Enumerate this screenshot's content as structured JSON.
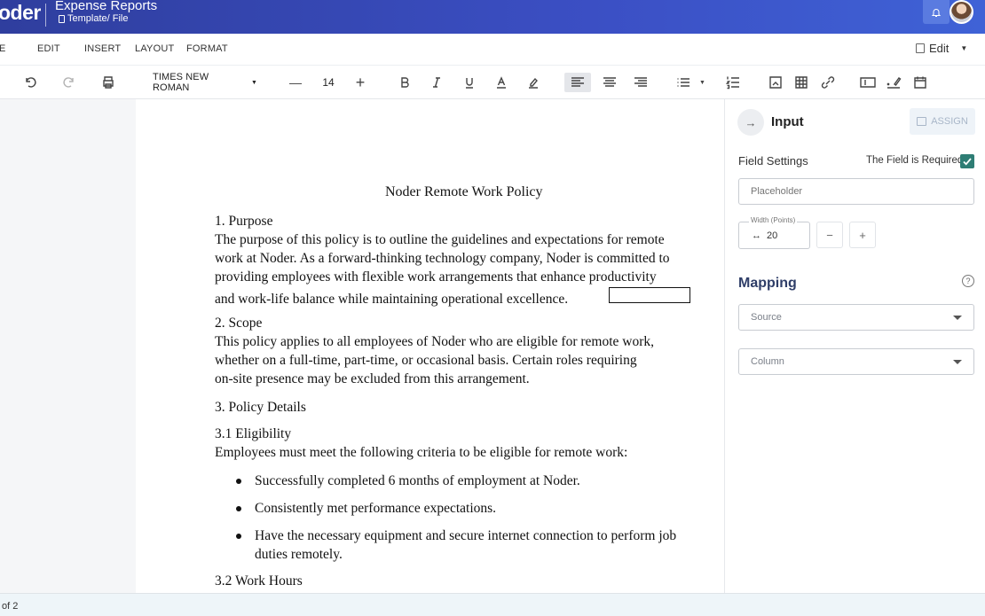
{
  "header": {
    "logo": "oder",
    "title": "Expense Reports",
    "path": "Template/ File"
  },
  "menu": {
    "items": [
      "E",
      "EDIT",
      "INSERT",
      "LAYOUT",
      "FORMAT"
    ],
    "mode_label": "Edit"
  },
  "toolbar": {
    "font_family": "TIMES NEW ROMAN",
    "font_size": "14",
    "icons": [
      "undo-icon",
      "redo-icon",
      "print-icon",
      "decrease-icon",
      "increase-icon",
      "bold-icon",
      "italic-icon",
      "underline-icon",
      "font-color-icon",
      "highlight-icon",
      "align-left-icon",
      "align-center-icon",
      "align-right-icon",
      "bullet-list-icon",
      "numbered-list-icon",
      "image-icon",
      "table-icon",
      "link-icon",
      "input-field-icon",
      "signature-icon",
      "date-icon"
    ]
  },
  "document": {
    "heading": "Noder Remote Work Policy",
    "lines": [
      "1. Purpose",
      "The purpose of this policy is to outline the guidelines and expectations for remote",
      "work at Noder. As a forward-thinking technology company, Noder is committed to",
      "providing employees with flexible work arrangements that enhance productivity",
      "and work-life balance while maintaining operational excellence.",
      "2. Scope",
      "This policy applies to all employees of Noder who are eligible for remote work,",
      "whether on a full-time, part-time, or occasional basis. Certain roles requiring",
      "on-site presence may be excluded from this arrangement.",
      "3. Policy Details",
      "3.1 Eligibility",
      "Employees must meet the following criteria to be eligible for remote work:",
      "3.2 Work Hours"
    ],
    "bullets": [
      "Successfully completed 6 months of employment at Noder.",
      "Consistently met performance expectations.",
      "Have the necessary equipment and secure internet connection to perform job",
      "duties remotely."
    ]
  },
  "status": {
    "page_count": "of 2"
  },
  "panel": {
    "title": "Input",
    "assign_label": "ASSIGN",
    "field_settings_label": "Field Settings",
    "required_label": "The Field is Required",
    "required_checked": true,
    "placeholder_hint": "Placeholder",
    "width_legend": "Width (Points)",
    "width_value": "20",
    "minus": "−",
    "plus": "+",
    "mapping_title": "Mapping",
    "source_hint": "Source",
    "column_hint": "Column"
  },
  "colors": {
    "header_start": "#2f3e9e",
    "header_end": "#3f62d6",
    "check": "#2e7d74",
    "mapping": "#2f3e68"
  }
}
